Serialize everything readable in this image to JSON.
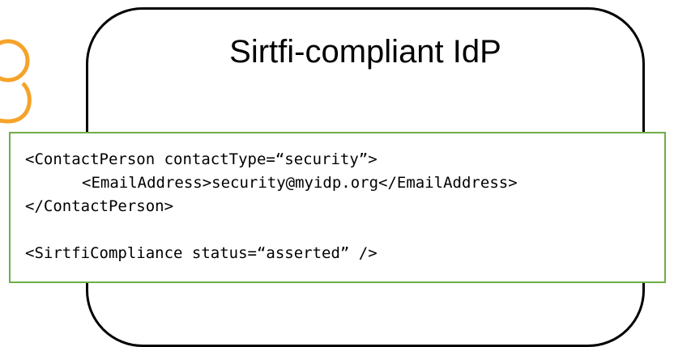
{
  "diagram": {
    "idp_title": "Sirtfi-compliant IdP",
    "code_lines": [
      "<ContactPerson contactType=“security”>",
      "<EmailAddress>security@myidp.org</EmailAddress>",
      "</ContactPerson>",
      "",
      "<SirtfiCompliance status=“asserted” />"
    ],
    "colors": {
      "box_border": "#000000",
      "code_border": "#70ad47",
      "icon_stroke": "#f5a32a"
    },
    "icon": "user-icon"
  }
}
